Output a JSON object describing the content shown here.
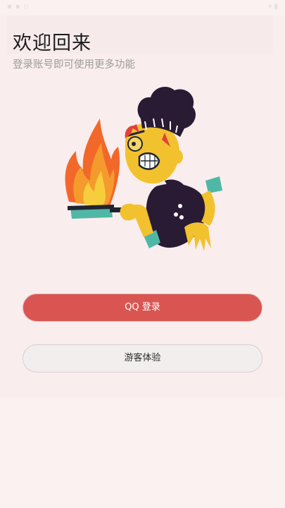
{
  "header": {
    "title": "欢迎回来",
    "subtitle": "登录账号即可使用更多功能"
  },
  "illustration": {
    "name": "chef-with-flaming-pan"
  },
  "buttons": {
    "qq_login": "QQ 登录",
    "guest": "游客体验"
  },
  "colors": {
    "primary": "#d95552",
    "background": "#fbf1f1",
    "secondary_button": "#f2eeee"
  }
}
